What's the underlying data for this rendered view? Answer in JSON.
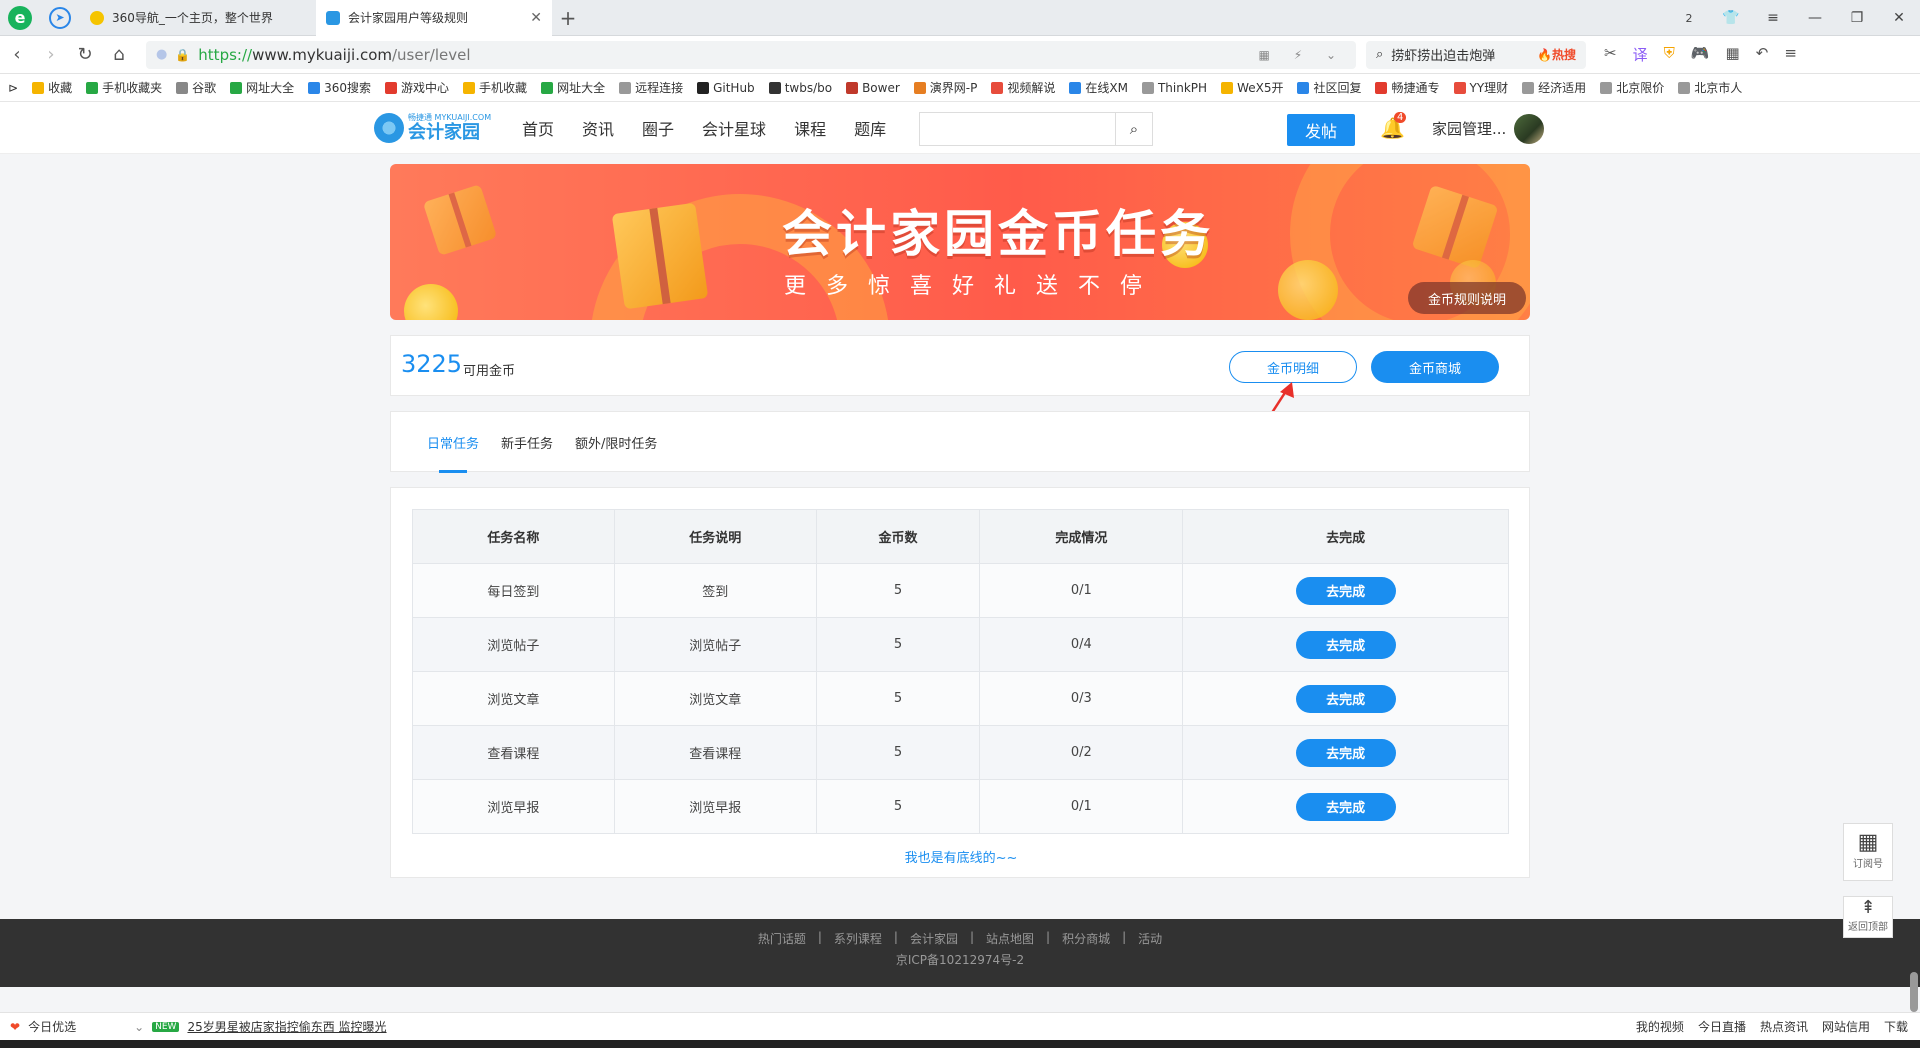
{
  "browser": {
    "tabs": [
      {
        "title": "360导航_一个主页，整个世界",
        "active": false
      },
      {
        "title": "会计家园用户等级规则",
        "active": true
      }
    ],
    "tab_count_badge": "2",
    "url_proto": "https://",
    "url_host": "www.mykuaiji.com",
    "url_path": "/user/level",
    "search_text": "捞虾捞出迫击炮弹",
    "search_hot": "🔥热搜",
    "bookmarks": [
      "收藏",
      "手机收藏夹",
      "谷歌",
      "网址大全",
      "360搜索",
      "游戏中心",
      "手机收藏",
      "网址大全",
      "远程连接",
      "GitHub",
      "twbs/bo",
      "Bower",
      "演界网-P",
      "视频解说",
      "在线XM",
      "ThinkPH",
      "WeX5开",
      "社区回复",
      "畅捷通专",
      "YY理财",
      "经济适用",
      "北京限价",
      "北京市人"
    ]
  },
  "site": {
    "logo_small": "畅捷通 MYKUAIJI.COM",
    "logo_text": "会计家园",
    "nav": [
      "首页",
      "资讯",
      "圈子",
      "会计星球",
      "课程",
      "题库"
    ],
    "search_placeholder": "",
    "post_button": "发帖",
    "notify_count": "4",
    "user_name": "家园管理..."
  },
  "banner": {
    "title": "会计家园金币任务",
    "subtitle": "更多惊喜好礼送不停",
    "rules_button": "金币规则说明"
  },
  "coins": {
    "amount": "3225",
    "label": "可用金币",
    "detail_button": "金币明细",
    "mall_button": "金币商城"
  },
  "task_tabs": [
    "日常任务",
    "新手任务",
    "额外/限时任务"
  ],
  "table": {
    "headers": [
      "任务名称",
      "任务说明",
      "金币数",
      "完成情况",
      "去完成"
    ],
    "rows": [
      {
        "name": "每日签到",
        "desc": "签到",
        "coins": "5",
        "progress": "0/1",
        "action": "去完成"
      },
      {
        "name": "浏览帖子",
        "desc": "浏览帖子",
        "coins": "5",
        "progress": "0/4",
        "action": "去完成"
      },
      {
        "name": "浏览文章",
        "desc": "浏览文章",
        "coins": "5",
        "progress": "0/3",
        "action": "去完成"
      },
      {
        "name": "查看课程",
        "desc": "查看课程",
        "coins": "5",
        "progress": "0/2",
        "action": "去完成"
      },
      {
        "name": "浏览早报",
        "desc": "浏览早报",
        "coins": "5",
        "progress": "0/1",
        "action": "去完成"
      }
    ],
    "end_text": "我也是有底线的~~"
  },
  "footer": {
    "links": [
      "热门话题",
      "|",
      "系列课程",
      "|",
      "会计家园",
      "|",
      "站点地图",
      "|",
      "积分商城",
      "|",
      "活动"
    ],
    "icp": "京ICP备10212974号-2"
  },
  "side": {
    "subscribe": "订阅号",
    "back_top": "返回顶部"
  },
  "statusbar": {
    "today_pick": "今日优选",
    "new_tag": "NEW",
    "news": "25岁男星被店家指控偷东西 监控曝光",
    "right_items": [
      "我的视频",
      "今日直播",
      "热点资讯",
      "网站信用",
      "下载"
    ]
  },
  "colors": {
    "accent": "#1a8ef0",
    "hot": "#f04a2a"
  }
}
